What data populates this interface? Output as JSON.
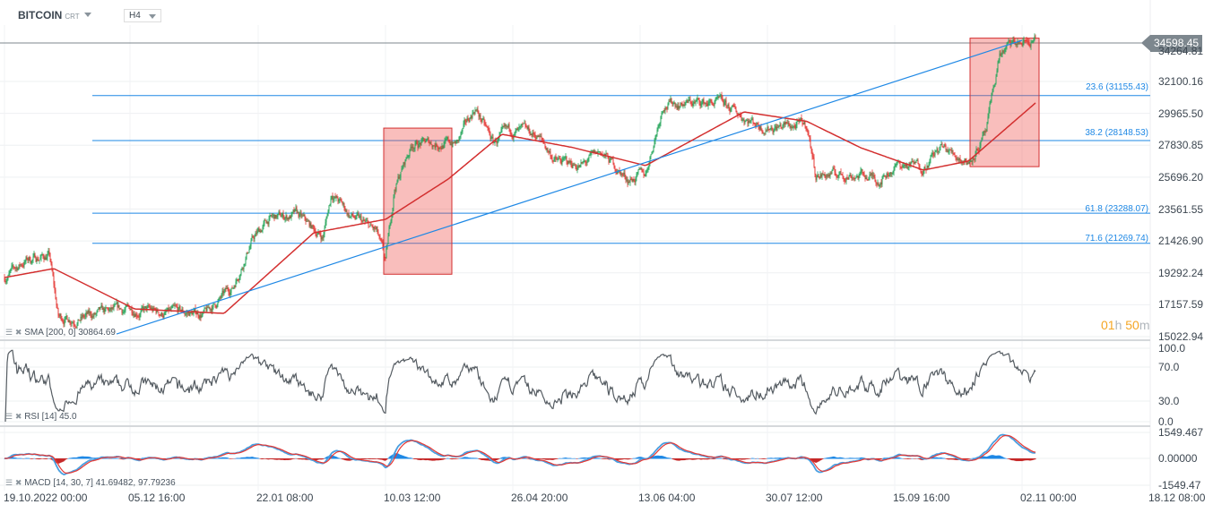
{
  "header": {
    "symbol": "BITCOIN",
    "symbol_suffix": "CRT",
    "timeframe": "H4"
  },
  "timer": {
    "hours": "01",
    "h": "h",
    "minutes": "50",
    "m": "m"
  },
  "current_price": "34598.45",
  "chart_data": [
    {
      "type": "candlestick",
      "title": "BITCOIN H4",
      "price_axis": [
        "32100.16",
        "29965.50",
        "27830.85",
        "25696.20",
        "23561.55",
        "21426.90",
        "19292.24",
        "17157.59",
        "15022.94"
      ],
      "hidden_axis_label": "34264.81",
      "ylim": [
        15022.94,
        34598.45
      ],
      "x_tick_labels": [
        "19.10.2022  00:00",
        "05.12  16:00",
        "22.01  08:00",
        "10.03  12:00",
        "26.04  20:00",
        "13.06  04:00",
        "30.07  12:00",
        "15.09  16:00",
        "02.11  00:00",
        "18.12  08:00"
      ],
      "price_path_bar_index": [
        0,
        50,
        100,
        120,
        170,
        230,
        290,
        350,
        450,
        510,
        550,
        590,
        650,
        710,
        730,
        770,
        830,
        850,
        870,
        910,
        970,
        1010,
        1050,
        1090,
        1130,
        1190,
        1230,
        1290,
        1330,
        1390,
        1430,
        1470,
        1530,
        1590,
        1630,
        1690,
        1750,
        1790,
        1810,
        1870,
        1910,
        1950,
        1990,
        2050,
        2090,
        2150,
        2190,
        2220,
        2250,
        2300
      ],
      "price_path": [
        18978,
        20176,
        20476,
        16280,
        16280,
        16580,
        16880,
        16580,
        16580,
        18378,
        21374,
        22872,
        23172,
        21674,
        24670,
        23172,
        21973,
        19876,
        24970,
        27966,
        27966,
        27966,
        30363,
        27966,
        28765,
        28465,
        26768,
        26468,
        27367,
        25569,
        25869,
        30663,
        30663,
        30663,
        30063,
        29128,
        29128,
        29128,
        25869,
        25869,
        25869,
        25569,
        26468,
        26468,
        27666,
        26768,
        28565,
        33958,
        34557,
        34857
      ],
      "sma": {
        "label": "SMA",
        "params": "[200, 0]",
        "value": "30864.69",
        "color": "#d32f2f",
        "bar_index": [
          0,
          110,
          290,
          490,
          690,
          850,
          990,
          1110,
          1270,
          1430,
          1650,
          1790,
          1910,
          2050,
          2150,
          2300
        ],
        "values": [
          18978,
          19577,
          16880,
          16580,
          21973,
          22872,
          25569,
          28565,
          27666,
          26468,
          30063,
          29428,
          27666,
          26169,
          26768,
          30663
        ]
      },
      "trendline": {
        "from": [
          250,
          15200
        ],
        "to": [
          2270,
          34850
        ],
        "color": "#1e88e5"
      },
      "fibonacci": [
        {
          "level": "23.6",
          "price": 31155.43,
          "label": "23.6 (31155.43)"
        },
        {
          "level": "38.2",
          "price": 28148.53,
          "label": "38.2 (28148.53)"
        },
        {
          "level": "61.8",
          "price": 23288.07,
          "label": "61.8 (23288.07)"
        },
        {
          "level": "71.6",
          "price": 21269.74,
          "label": "71.6 (21269.74)"
        }
      ],
      "highlight_boxes": [
        {
          "bar_from": 846,
          "bar_to": 998,
          "price_high": 28980,
          "price_low": 19200
        },
        {
          "bar_from": 2154,
          "bar_to": 2308,
          "price_high": 35000,
          "price_low": 26400
        }
      ]
    },
    {
      "type": "line",
      "name": "RSI",
      "params": "[14]",
      "value": "45.0",
      "axis": [
        "100.0",
        "70.0",
        "30.0",
        "0.0"
      ],
      "ylim": [
        0,
        100
      ]
    },
    {
      "type": "bar",
      "name": "MACD",
      "params": "[14, 30, 7]",
      "value1": "41.69482",
      "value2": "97.79236",
      "axis": [
        "1549.467",
        "0.00000",
        "-1549.47"
      ],
      "ylim": [
        -1549.47,
        1549.467
      ]
    }
  ]
}
